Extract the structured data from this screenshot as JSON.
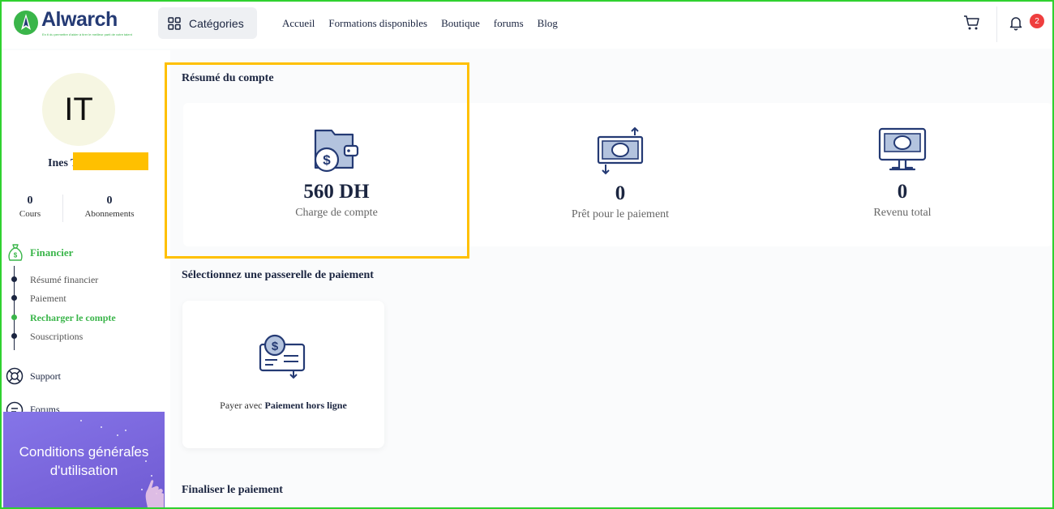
{
  "header": {
    "logo_text": "Alwarch",
    "logo_tagline": "En ti du permettre d'aider à tirer le meilleur parti de votre talent",
    "categories_label": "Catégories",
    "nav": [
      "Accueil",
      "Formations disponibles",
      "Boutique",
      "forums",
      "Blog"
    ],
    "notification_count": "2",
    "icons": [
      "grid-icon",
      "cart-icon",
      "bell-icon"
    ]
  },
  "sidebar": {
    "avatar_initials": "IT",
    "user_name": "Ines T",
    "stats": [
      {
        "value": "0",
        "label": "Cours"
      },
      {
        "value": "0",
        "label": "Abonnements"
      }
    ],
    "financier_label": "Financier",
    "sub_items": [
      {
        "label": "Résumé financier",
        "active": false
      },
      {
        "label": "Paiement",
        "active": false
      },
      {
        "label": "Recharger le compte",
        "active": true
      },
      {
        "label": "Souscriptions",
        "active": false
      }
    ],
    "support_label": "Support",
    "forums_label": "Forums",
    "promo_line1": "Conditions générales",
    "promo_line2": "d'utilisation"
  },
  "main": {
    "summary_title": "Résumé du compte",
    "metrics": [
      {
        "value": "560 DH",
        "label": "Charge de compte",
        "icon": "wallet-dollar-icon"
      },
      {
        "value": "0",
        "label": "Prêt pour le paiement",
        "icon": "money-transfer-icon"
      },
      {
        "value": "0",
        "label": "Revenu total",
        "icon": "money-monitor-icon"
      }
    ],
    "gateway_title": "Sélectionnez une passerelle de paiement",
    "gateway_prefix": "Payer avec ",
    "gateway_name": "Paiement hors ligne",
    "finalize_title": "Finaliser le paiement"
  },
  "colors": {
    "brand_green": "#3ab54a",
    "navy": "#1b2540",
    "highlight": "#ffc000",
    "badge": "#ef3e3e",
    "frame": "#2fd12f"
  }
}
